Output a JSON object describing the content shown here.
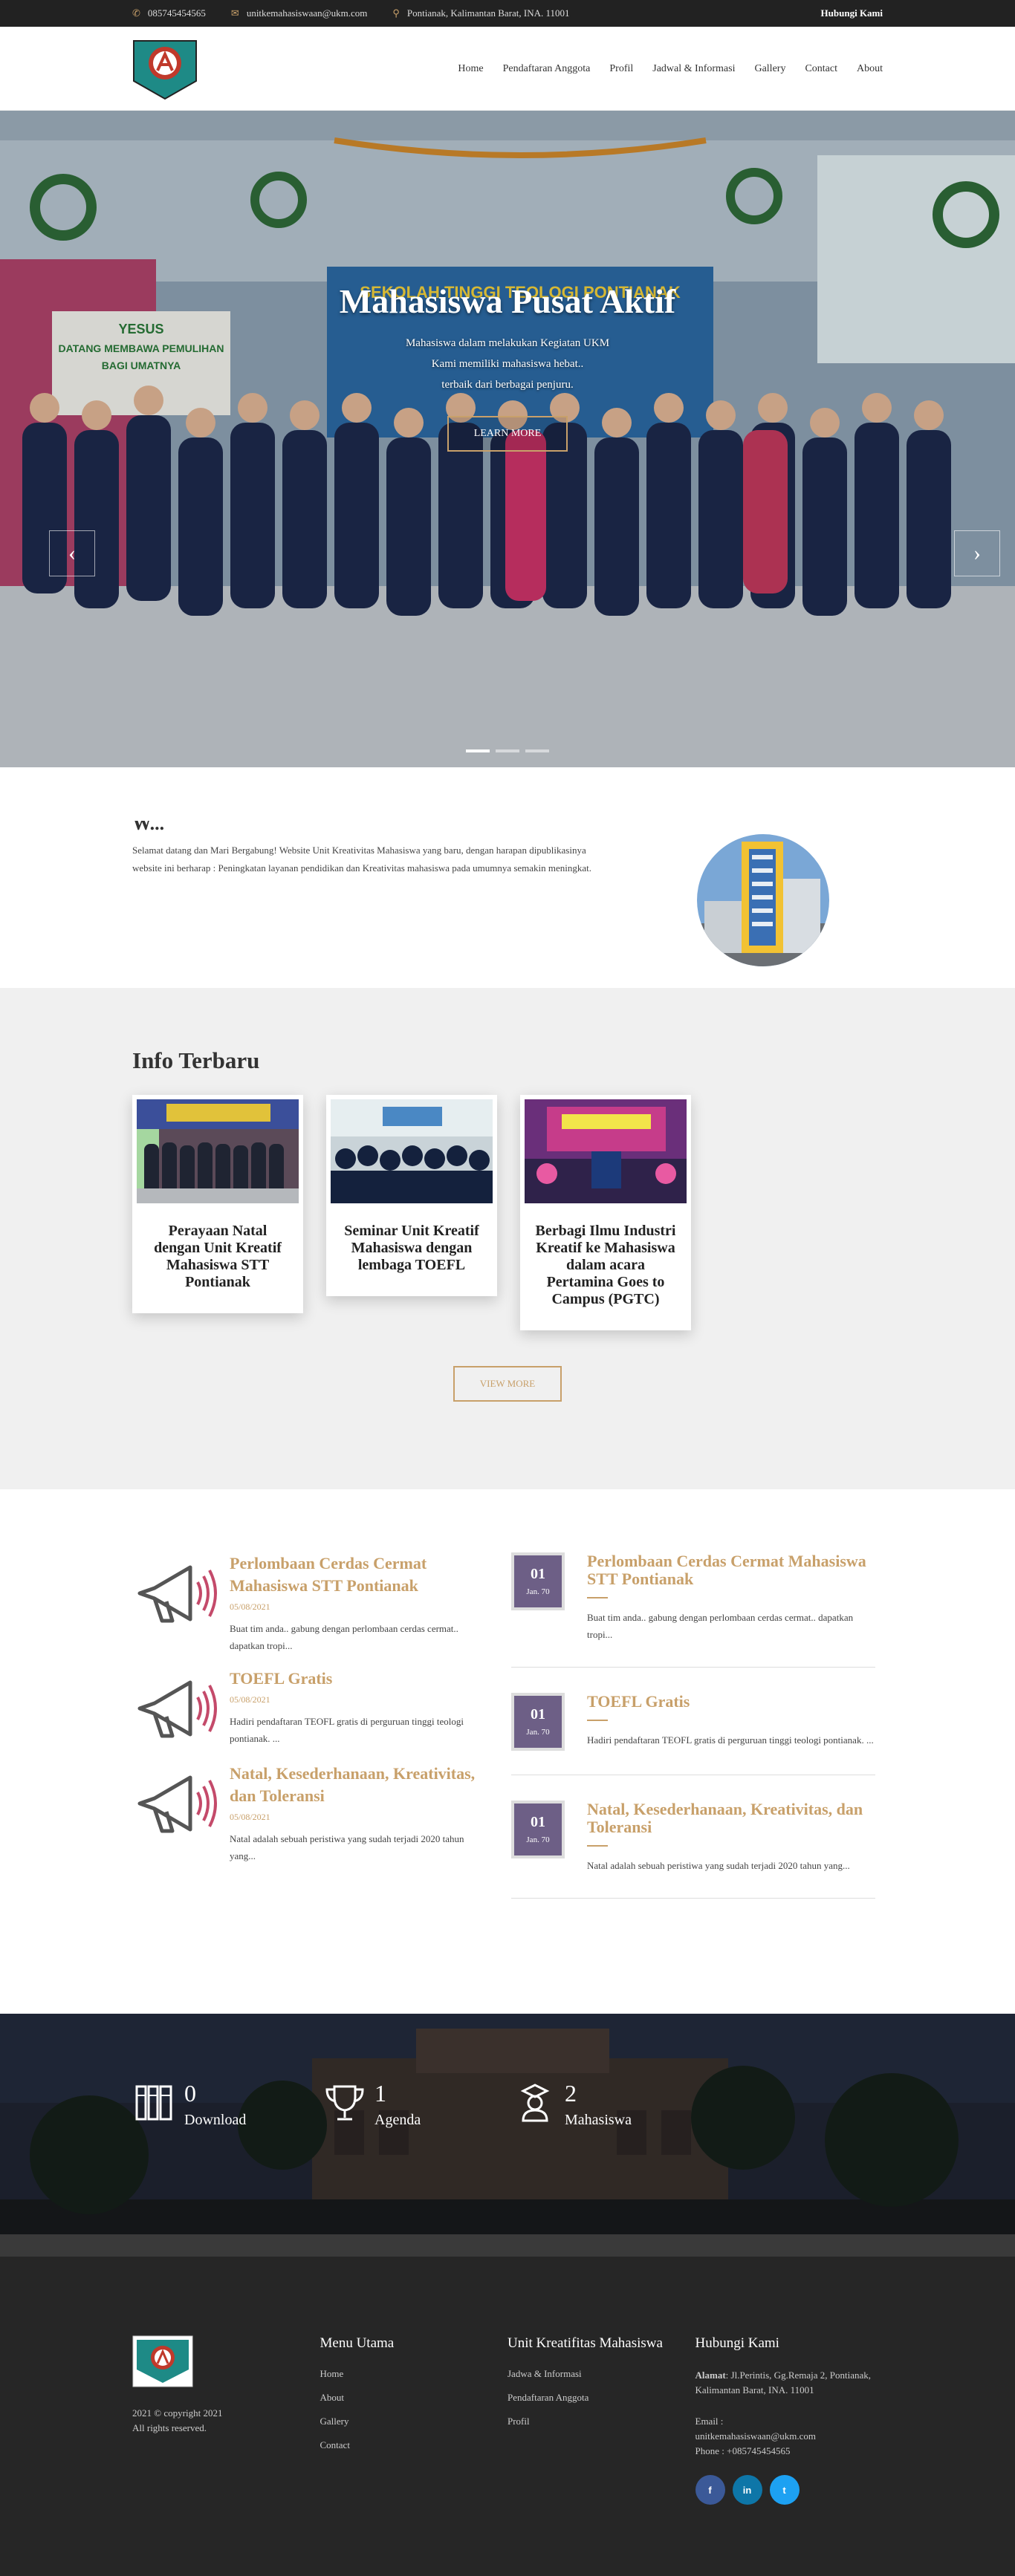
{
  "topbar": {
    "phone": "085745454565",
    "email": "unitkemahasiswaan@ukm.com",
    "address": "Pontianak, Kalimantan Barat, INA. 11001",
    "cta": "Hubungi Kami"
  },
  "nav": [
    "Home",
    "Pendaftaran Anggota",
    "Profil",
    "Jadwal & Informasi",
    "Gallery",
    "Contact",
    "About"
  ],
  "hero": {
    "title": "Mahasiswa Pusat Aktif",
    "line1": "Mahasiswa dalam melakukan Kegiatan UKM",
    "line2": "Kami memiliki mahasiswa hebat..",
    "line3": "terbaik dari berbagai penjuru.",
    "button": "LEARN MORE",
    "banner_text": "SEKOLAH TINGGI TEOLOGI PONTIANAK",
    "sign_line1": "YESUS",
    "sign_line2": "DATANG MEMBAWA PEMULIHAN",
    "sign_line3": "BAGI UMATNYA"
  },
  "welcome": {
    "heading": "W...",
    "text": "Selamat datang dan Mari Bergabung! Website Unit Kreativitas Mahasiswa yang baru, dengan harapan dipublikasinya website ini berharap : Peningkatan layanan pendidikan dan Kreativitas mahasiswa pada umumnya semakin meningkat."
  },
  "info": {
    "title": "Info Terbaru",
    "cards": [
      {
        "title": "Perayaan Natal dengan Unit Kreatif Mahasiswa STT Pontianak"
      },
      {
        "title": "Seminar Unit Kreatif Mahasiswa dengan lembaga TOEFL"
      },
      {
        "title": "Berbagi Ilmu Industri Kreatif ke Mahasiswa dalam acara Pertamina Goes to Campus (PGTC)"
      }
    ],
    "button": "VIEW MORE"
  },
  "news_left": [
    {
      "title": "Perlombaan Cerdas Cermat Mahasiswa STT Pontianak",
      "date": "05/08/2021",
      "excerpt": "Buat tim anda.. gabung dengan perlombaan cerdas cermat.. dapatkan tropi..."
    },
    {
      "title": "TOEFL Gratis",
      "date": "05/08/2021",
      "excerpt": "Hadiri pendaftaran TEOFL gratis di perguruan tinggi teologi pontianak. ..."
    },
    {
      "title": "Natal, Kesederhanaan, Kreativitas, dan Toleransi",
      "date": "05/08/2021",
      "excerpt": "Natal adalah sebuah peristiwa yang sudah terjadi 2020 tahun yang..."
    }
  ],
  "news_right": [
    {
      "day": "01",
      "month": "Jan. 70",
      "title": "Perlombaan Cerdas Cermat Mahasiswa STT Pontianak",
      "excerpt": "Buat tim anda.. gabung dengan perlombaan cerdas cermat.. dapatkan tropi..."
    },
    {
      "day": "01",
      "month": "Jan. 70",
      "title": "TOEFL Gratis",
      "excerpt": "Hadiri pendaftaran TEOFL gratis di perguruan tinggi teologi pontianak. ..."
    },
    {
      "day": "01",
      "month": "Jan. 70",
      "title": "Natal, Kesederhanaan, Kreativitas, dan Toleransi",
      "excerpt": "Natal adalah sebuah peristiwa yang sudah terjadi 2020 tahun yang..."
    }
  ],
  "stats": [
    {
      "value": "0",
      "label": "Download",
      "icon": "books-icon"
    },
    {
      "value": "1",
      "label": "Agenda",
      "icon": "trophy-icon"
    },
    {
      "value": "2",
      "label": "Mahasiswa",
      "icon": "student-icon"
    }
  ],
  "footer": {
    "copyright1": "2021 © copyright 2021",
    "copyright2": "All rights reserved.",
    "menu_title": "Menu Utama",
    "menu": [
      "Home",
      "About",
      "Gallery",
      "Contact"
    ],
    "ukm_title": "Unit Kreatifitas Mahasiswa",
    "ukm_links": [
      "Jadwa & Informasi",
      "Pendaftaran Anggota",
      "Profil"
    ],
    "contact_title": "Hubungi Kami",
    "address_label": "Alamat",
    "address": ": Jl.Perintis, Gg.Remaja 2, Pontianak, Kalimantan Barat, INA. 11001",
    "email_label": "Email :",
    "email": "unitkemahasiswaan@ukm.com",
    "phone": "Phone : +085745454565",
    "social": [
      "f",
      "in",
      "t"
    ]
  },
  "colors": {
    "accent": "#c8a06a",
    "dark": "#222222",
    "date_box": "#6d5f86",
    "facebook": "#3b5998",
    "linkedin": "#0e76a8",
    "twitter": "#1da1f2"
  }
}
